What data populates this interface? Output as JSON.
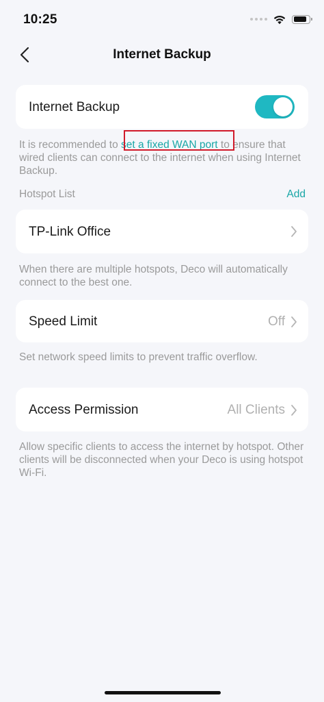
{
  "status_bar": {
    "time": "10:25",
    "icons": [
      "cellular-signal-icon",
      "wifi-icon",
      "battery-icon"
    ],
    "battery_level": 0.88
  },
  "nav": {
    "title": "Internet Backup",
    "back_icon": "chevron-left-icon"
  },
  "internet_backup": {
    "label": "Internet Backup",
    "enabled": true
  },
  "recommend_hint": {
    "before": "It is recommended to ",
    "link": "set a fixed WAN port",
    "after": " to ensure that wired clients can connect to the internet when using Internet Backup."
  },
  "hotspot_list": {
    "header": "Hotspot List",
    "add_label": "Add",
    "items": [
      {
        "name": "TP-Link Office"
      }
    ],
    "hint": "When there are multiple hotspots, Deco will automatically connect to the best one."
  },
  "speed_limit": {
    "label": "Speed Limit",
    "value": "Off",
    "hint": "Set network speed limits to prevent traffic overflow."
  },
  "access_permission": {
    "label": "Access Permission",
    "value": "All Clients",
    "hint": "Allow specific clients to access the internet by hotspot. Other clients will be disconnected when your Deco is using hotspot Wi-Fi."
  },
  "colors": {
    "accent": "#19a6a6",
    "toggle_on": "#1fb8c2",
    "background": "#f5f6fa",
    "card": "#ffffff",
    "secondary_text": "#9a9a9a",
    "highlight_box": "#d11a2a"
  }
}
